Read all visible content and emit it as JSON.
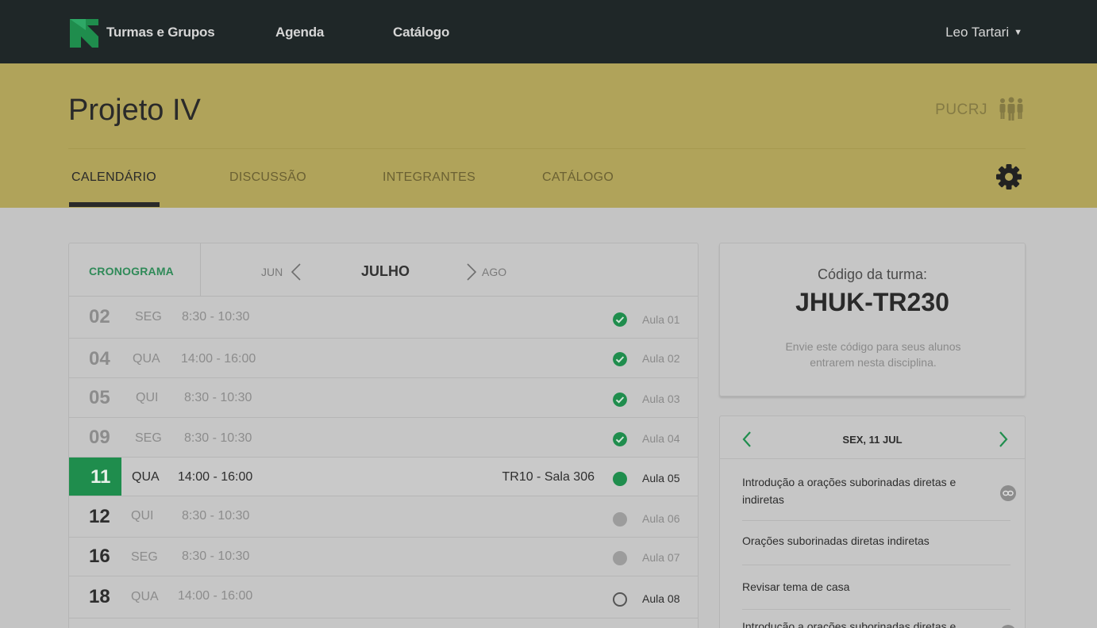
{
  "topnav": {
    "brand": "Turmas e Grupos",
    "links": [
      "Agenda",
      "Catálogo"
    ],
    "user": "Leo Tartari",
    "caret": "▼"
  },
  "project": {
    "title": "Projeto IV",
    "org": "PUCRJ",
    "tabs": [
      "CALENDÁRIO",
      "DISCUSSÃO",
      "INTEGRANTES",
      "CATÁLOGO"
    ],
    "active_tab": "CALENDÁRIO"
  },
  "schedule": {
    "section_label": "CRONOGRAMA",
    "prev_month": "JUN",
    "current_month": "JULHO",
    "next_month": "AGO",
    "rows": [
      {
        "day": "02",
        "weekday": "SEG",
        "time": "8:30 - 10:30",
        "location": "",
        "status": "done",
        "aula": "Aula 01"
      },
      {
        "day": "04",
        "weekday": "QUA",
        "time": "14:00 - 16:00",
        "location": "",
        "status": "done",
        "aula": "Aula 02"
      },
      {
        "day": "05",
        "weekday": "QUI",
        "time": "8:30 - 10:30",
        "location": "",
        "status": "done",
        "aula": "Aula 03"
      },
      {
        "day": "09",
        "weekday": "SEG",
        "time": "8:30 - 10:30",
        "location": "",
        "status": "done",
        "aula": "Aula 04"
      },
      {
        "day": "11",
        "weekday": "QUA",
        "time": "14:00 - 16:00",
        "location": "TR10 - Sala 306",
        "status": "current",
        "aula": "Aula 05"
      },
      {
        "day": "12",
        "weekday": "QUI",
        "time": "8:30 - 10:30",
        "location": "",
        "status": "planned",
        "aula": "Aula 06"
      },
      {
        "day": "16",
        "weekday": "SEG",
        "time": "8:30 - 10:30",
        "location": "",
        "status": "planned",
        "aula": "Aula 07"
      },
      {
        "day": "18",
        "weekday": "QUA",
        "time": "14:00 - 16:00",
        "location": "",
        "status": "empty",
        "aula": "Aula 08"
      }
    ]
  },
  "class_code": {
    "label": "Código da turma:",
    "code": "JHUK-TR230",
    "description": "Envie este código para seus alunos entrarem nesta disciplina."
  },
  "day_panel": {
    "date": "SEX, 11 JUL",
    "items": [
      {
        "text": "Introdução a orações suborinadas diretas e indiretas",
        "icon": "link-icon"
      },
      {
        "text": "Orações suborinadas diretas  indiretas",
        "icon": ""
      },
      {
        "text": "Revisar tema de casa",
        "icon": ""
      },
      {
        "text": "Introdução a orações suborinadas diretas e indiretas",
        "icon": "link-icon"
      }
    ]
  },
  "colors": {
    "nav_bg": "#1f2728",
    "header_bg": "#b0a35a",
    "accent_green": "#1f8d4d",
    "page_bg": "#c4c4c4"
  }
}
